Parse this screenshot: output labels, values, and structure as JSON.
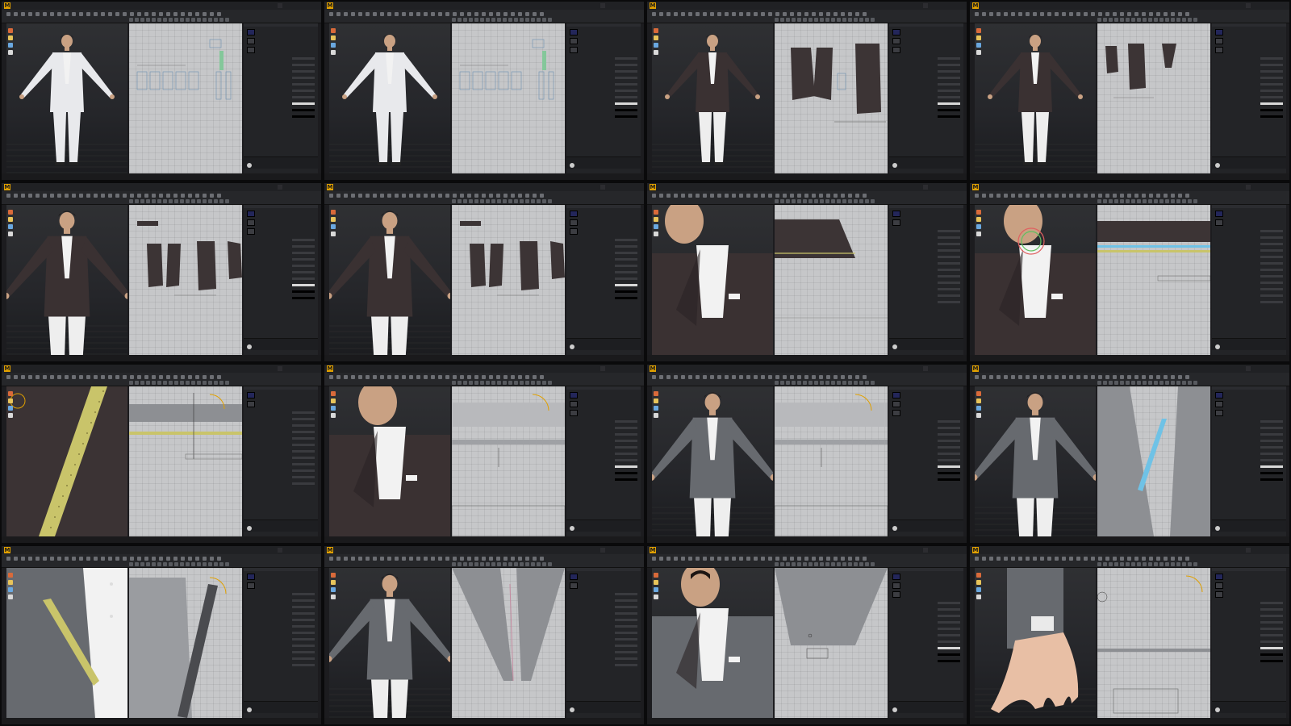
{
  "menus": [
    "File",
    "Edit",
    "3D Garment",
    "2D Pattern",
    "Sewing",
    "Materials",
    "Avatar",
    "Display",
    "Preferences",
    "Settings",
    "Help"
  ],
  "simulation_label": "SIMULATION",
  "colors": {
    "accent": "#e0a000",
    "panel_bg": "#232427",
    "pattern_bg": "#c6c7c9",
    "white_suit": "#e8e9ec",
    "dark_suit": "#3a3132",
    "gray_suit": "#676a6f",
    "swatch_navy": "#23265a",
    "highlight_yellow": "#c9c46a",
    "highlight_cyan": "#6fc2e6"
  },
  "tiles": [
    {
      "id": 1,
      "scene": "white-suit-full",
      "suit": "white_suit",
      "pattern": "white-pieces",
      "panel": "fabric"
    },
    {
      "id": 2,
      "scene": "white-suit-full",
      "suit": "white_suit",
      "pattern": "white-pieces",
      "panel": "fabric"
    },
    {
      "id": 3,
      "scene": "dark-suit-full",
      "suit": "dark_suit",
      "pattern": "vest-dark",
      "panel": "fabric"
    },
    {
      "id": 4,
      "scene": "dark-suit-full",
      "suit": "dark_suit",
      "pattern": "vest-small",
      "panel": "fabric"
    },
    {
      "id": 5,
      "scene": "dark-suit-upper",
      "suit": "dark_suit",
      "pattern": "vest-row",
      "panel": "fabric"
    },
    {
      "id": 6,
      "scene": "dark-suit-upper",
      "suit": "dark_suit",
      "pattern": "vest-row",
      "panel": "fabric"
    },
    {
      "id": 7,
      "scene": "collar-closeup",
      "suit": "dark_suit",
      "pattern": "trapezoid",
      "panel": "properties"
    },
    {
      "id": 8,
      "scene": "collar-gizmo",
      "suit": "dark_suit",
      "pattern": "stripes",
      "panel": "properties"
    },
    {
      "id": 9,
      "scene": "lapel-pattern",
      "suit": "dark_suit",
      "pattern": "gizmo-grid",
      "panel": "properties"
    },
    {
      "id": 10,
      "scene": "face-closeup",
      "suit": "dark_suit",
      "pattern": "seam-lines",
      "panel": "fabric"
    },
    {
      "id": 11,
      "scene": "gray-suit-upper",
      "suit": "gray_suit",
      "pattern": "seam-lines",
      "panel": "fabric"
    },
    {
      "id": 12,
      "scene": "gray-suit-upper",
      "suit": "gray_suit",
      "pattern": "cyan-strip",
      "panel": "fabric"
    },
    {
      "id": 13,
      "scene": "gray-lapel-closeup",
      "suit": "gray_suit",
      "pattern": "diagonal-strip",
      "panel": "properties"
    },
    {
      "id": 14,
      "scene": "gray-suit-upper",
      "suit": "gray_suit",
      "pattern": "v-pieces",
      "panel": "properties"
    },
    {
      "id": 15,
      "scene": "gray-suit-face",
      "suit": "gray_suit",
      "pattern": "pocket-piece",
      "panel": "fabric"
    },
    {
      "id": 16,
      "scene": "hand-closeup",
      "suit": "gray_suit",
      "pattern": "cuff-piece",
      "panel": "fabric"
    }
  ]
}
